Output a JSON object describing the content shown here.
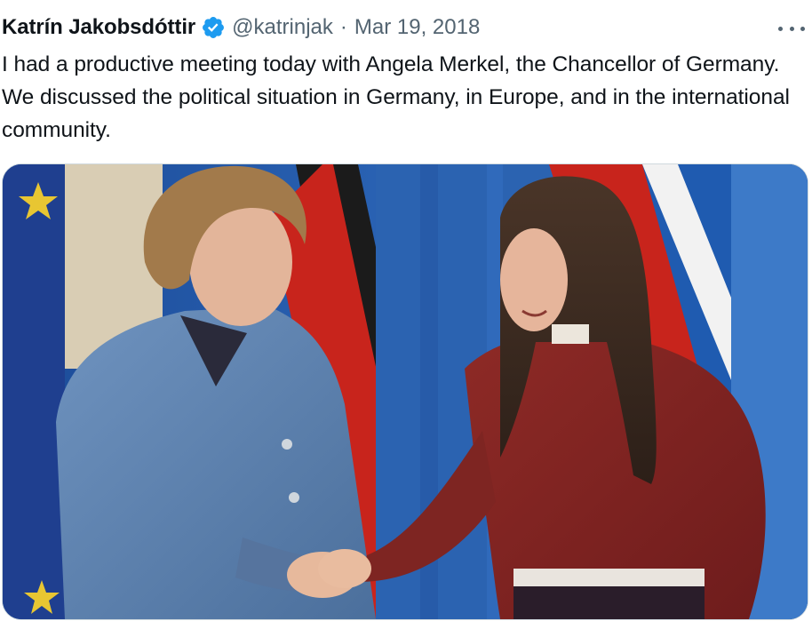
{
  "tweet": {
    "author": {
      "name": "Katrín Jakobsdóttir",
      "handle": "@katrinjak",
      "verified": true,
      "verified_icon": "verified-badge-icon"
    },
    "separator": "·",
    "date": "Mar 19, 2018",
    "more_icon": "more-options-icon",
    "text": "I had a productive meeting today with Angela Merkel, the Chancellor of Germany. We discussed the political situation in Germany, in Europe, and in the international community.",
    "media": {
      "type": "photo",
      "alt": ""
    }
  },
  "colors": {
    "text_primary": "#0f1419",
    "text_secondary": "#536471",
    "verified_blue": "#1d9bf0",
    "border": "#cfd9de"
  }
}
